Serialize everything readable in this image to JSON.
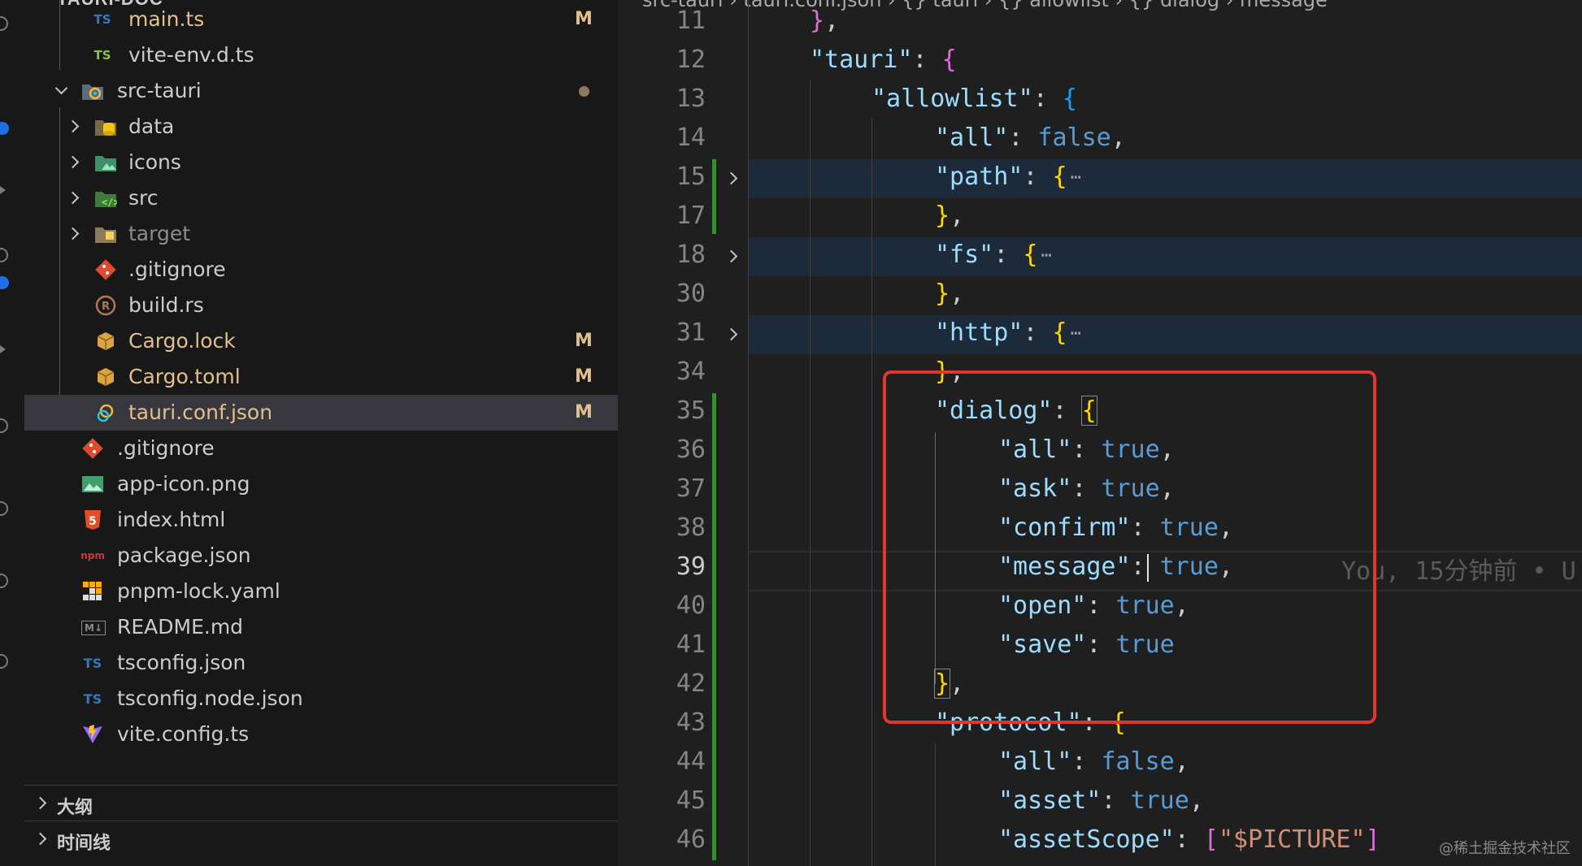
{
  "explorer": {
    "header_fragment": "TAURI-DOC",
    "files": [
      {
        "name": "main.ts",
        "icon": "typescript-icon",
        "icon_text": "TS",
        "icon_color": "#3178c6",
        "status": "M"
      },
      {
        "name": "vite-env.d.ts",
        "icon": "typescript-icon",
        "icon_text": "TS",
        "icon_color": "#8bc34a",
        "status": ""
      },
      {
        "name": "src-tauri",
        "icon": "tauri-folder-icon",
        "status": "dot"
      },
      {
        "name": "data",
        "icon": "database-folder-icon"
      },
      {
        "name": "icons",
        "icon": "images-folder-icon"
      },
      {
        "name": "src",
        "icon": "src-folder-icon"
      },
      {
        "name": "target",
        "icon": "target-folder-icon"
      },
      {
        "name": ".gitignore",
        "icon": "git-icon"
      },
      {
        "name": "build.rs",
        "icon": "rust-icon"
      },
      {
        "name": "Cargo.lock",
        "icon": "cargo-icon",
        "status": "M"
      },
      {
        "name": "Cargo.toml",
        "icon": "cargo-icon",
        "status": "M"
      },
      {
        "name": "tauri.conf.json",
        "icon": "tauri-icon",
        "status": "M"
      },
      {
        "name": ".gitignore",
        "icon": "git-icon"
      },
      {
        "name": "app-icon.png",
        "icon": "image-icon"
      },
      {
        "name": "index.html",
        "icon": "html5-icon",
        "icon_text": "5"
      },
      {
        "name": "package.json",
        "icon": "npm-icon",
        "icon_text": "npm"
      },
      {
        "name": "pnpm-lock.yaml",
        "icon": "pnpm-icon"
      },
      {
        "name": "README.md",
        "icon": "markdown-icon",
        "icon_text": "M↓"
      },
      {
        "name": "tsconfig.json",
        "icon": "tsconfig-icon",
        "icon_text": "TS"
      },
      {
        "name": "tsconfig.node.json",
        "icon": "tsconfig-icon",
        "icon_text": "TS"
      },
      {
        "name": "vite.config.ts",
        "icon": "vite-icon"
      }
    ],
    "panels": [
      {
        "label": "大纲"
      },
      {
        "label": "时间线"
      }
    ]
  },
  "editor": {
    "breadcrumb": "src-tauri › tauri.conf.json › {} tauri › {} allowlist › {} dialog › message",
    "active_line": "39",
    "blame": "You, 15分钟前 • U",
    "lines": [
      {
        "n": "11"
      },
      {
        "n": "12"
      },
      {
        "n": "13"
      },
      {
        "n": "14"
      },
      {
        "n": "15"
      },
      {
        "n": "17"
      },
      {
        "n": "18"
      },
      {
        "n": "30"
      },
      {
        "n": "31"
      },
      {
        "n": "34"
      },
      {
        "n": "35"
      },
      {
        "n": "36"
      },
      {
        "n": "37"
      },
      {
        "n": "38"
      },
      {
        "n": "39"
      },
      {
        "n": "40"
      },
      {
        "n": "41"
      },
      {
        "n": "42"
      },
      {
        "n": "43"
      },
      {
        "n": "44"
      },
      {
        "n": "45"
      },
      {
        "n": "46"
      }
    ],
    "tokens": {
      "tauri": "\"tauri\"",
      "allowlist": "\"allowlist\"",
      "all": "\"all\"",
      "path": "\"path\"",
      "fs": "\"fs\"",
      "http": "\"http\"",
      "dialog": "\"dialog\"",
      "ask": "\"ask\"",
      "confirm": "\"confirm\"",
      "message": "\"message\"",
      "open": "\"open\"",
      "save": "\"save\"",
      "protocol": "\"protocol\"",
      "asset": "\"asset\"",
      "assetScope": "\"assetScope\"",
      "picture": "\"$PICTURE\"",
      "true": "true",
      "false": "false"
    }
  },
  "watermark": "@稀土掘金技术社区",
  "colors": {
    "highlight_box": "#e0362c",
    "modified": "#e2c08d",
    "git_added": "#388a34"
  }
}
